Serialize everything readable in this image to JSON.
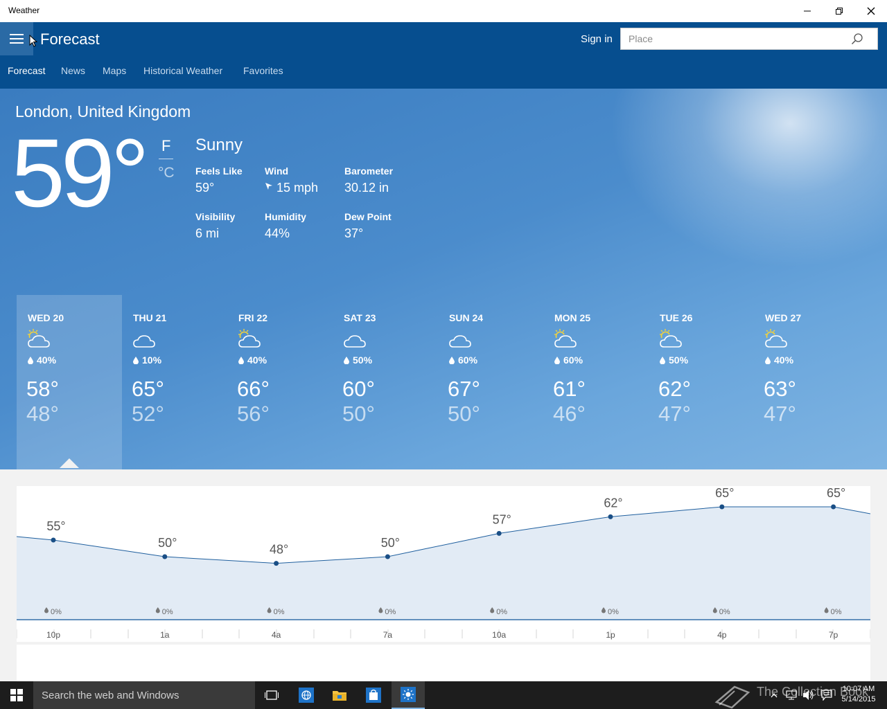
{
  "window": {
    "title": "Weather"
  },
  "header": {
    "title": "Forecast",
    "sign_in": "Sign in",
    "search_placeholder": "Place"
  },
  "nav": {
    "tabs": [
      {
        "label": "Forecast",
        "active": true
      },
      {
        "label": "News"
      },
      {
        "label": "Maps"
      },
      {
        "label": "Historical Weather"
      },
      {
        "label": "Favorites"
      }
    ]
  },
  "current": {
    "location": "London, United Kingdom",
    "temperature": "59°",
    "unit_f": "F",
    "unit_c": "°C",
    "condition": "Sunny",
    "details": [
      {
        "label": "Feels Like",
        "value": "59°"
      },
      {
        "label": "Wind",
        "value": "15 mph"
      },
      {
        "label": "Barometer",
        "value": "30.12 in"
      },
      {
        "label": "Visibility",
        "value": "6 mi"
      },
      {
        "label": "Humidity",
        "value": "44%"
      },
      {
        "label": "Dew Point",
        "value": "37°"
      }
    ]
  },
  "daily": [
    {
      "day": "WED 20",
      "icon": "partly-sunny-icon",
      "precip": "40%",
      "high": "58°",
      "low": "48°",
      "selected": true
    },
    {
      "day": "THU 21",
      "icon": "cloudy-icon",
      "precip": "10%",
      "high": "65°",
      "low": "52°"
    },
    {
      "day": "FRI 22",
      "icon": "partly-sunny-icon",
      "precip": "40%",
      "high": "66°",
      "low": "56°"
    },
    {
      "day": "SAT 23",
      "icon": "cloudy-icon",
      "precip": "50%",
      "high": "60°",
      "low": "50°"
    },
    {
      "day": "SUN 24",
      "icon": "cloudy-icon",
      "precip": "60%",
      "high": "67°",
      "low": "50°"
    },
    {
      "day": "MON 25",
      "icon": "partly-sunny-icon",
      "precip": "60%",
      "high": "61°",
      "low": "46°"
    },
    {
      "day": "TUE 26",
      "icon": "partly-sunny-icon",
      "precip": "50%",
      "high": "62°",
      "low": "47°"
    },
    {
      "day": "WED 27",
      "icon": "partly-sunny-icon",
      "precip": "40%",
      "high": "63°",
      "low": "47°"
    }
  ],
  "hourly": {
    "points": [
      {
        "time": "10p",
        "temp": 55,
        "label": "55°",
        "precip": "0%"
      },
      {
        "time": "1a",
        "temp": 50,
        "label": "50°",
        "precip": "0%"
      },
      {
        "time": "4a",
        "temp": 48,
        "label": "48°",
        "precip": "0%"
      },
      {
        "time": "7a",
        "temp": 50,
        "label": "50°",
        "precip": "0%"
      },
      {
        "time": "10a",
        "temp": 57,
        "label": "57°",
        "precip": "0%"
      },
      {
        "time": "1p",
        "temp": 62,
        "label": "62°",
        "precip": "0%"
      },
      {
        "time": "4p",
        "temp": 65,
        "label": "65°",
        "precip": "0%"
      },
      {
        "time": "7p",
        "temp": 65,
        "label": "65°",
        "precip": "0%"
      }
    ]
  },
  "taskbar": {
    "search_placeholder": "Search the web and Windows",
    "watermark": "The Collection Book",
    "time": "10:07 AM",
    "date": "5/14/2015"
  },
  "colors": {
    "header": "#064e8f",
    "hero": "#4b8ccc",
    "chart_line": "#1f5f9e",
    "chart_fill": "#e2ebf5"
  }
}
